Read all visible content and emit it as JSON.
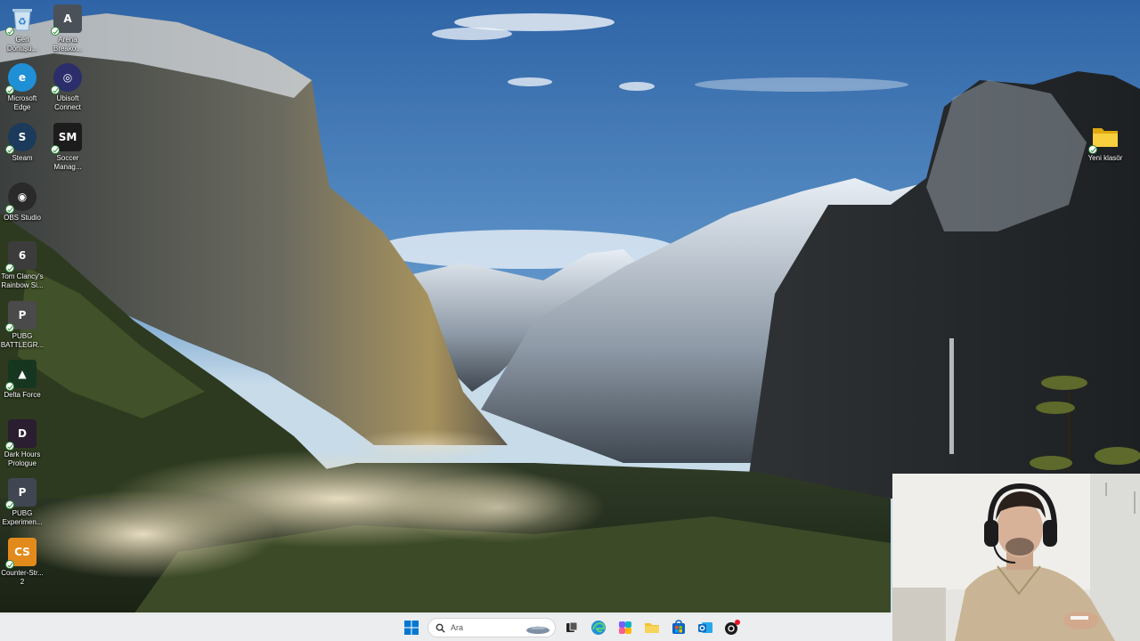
{
  "desktop": {
    "icons": [
      {
        "label": "Geri\nDönüşü...",
        "icon": "recycle-bin-icon",
        "color": "#6ba6d8",
        "glyph": "♻"
      },
      {
        "label": "Arena\nBreako...",
        "icon": "arena-breakout-icon",
        "color": "#4b5158",
        "glyph": "A"
      },
      {
        "label": "Microsoft\nEdge",
        "icon": "edge-icon",
        "color": "#1f8fd6",
        "glyph": "e"
      },
      {
        "label": "Ubisoft\nConnect",
        "icon": "ubisoft-connect-icon",
        "color": "#2b2e6b",
        "glyph": "◎"
      },
      {
        "label": "Steam",
        "icon": "steam-icon",
        "color": "#1b3a5c",
        "glyph": "S"
      },
      {
        "label": "Soccer\nManag...",
        "icon": "soccer-manager-icon",
        "color": "#1c1c1c",
        "glyph": "SM"
      },
      {
        "label": "OBS Studio",
        "icon": "obs-studio-icon",
        "color": "#2a2a2a",
        "glyph": "◉"
      },
      {
        "label": "Tom Clancy's\nRainbow Si...",
        "icon": "rainbow-six-icon",
        "color": "#3c3c3c",
        "glyph": "6"
      },
      {
        "label": "PUBG\nBATTLEGR...",
        "icon": "pubg-icon",
        "color": "#4a4a4a",
        "glyph": "P"
      },
      {
        "label": "Delta Force",
        "icon": "delta-force-icon",
        "color": "#16361f",
        "glyph": "▲"
      },
      {
        "label": "Dark Hours\nPrologue",
        "icon": "dark-hours-icon",
        "color": "#2a1e30",
        "glyph": "D"
      },
      {
        "label": "PUBG\nExperimen...",
        "icon": "pubg-experimental-icon",
        "color": "#404652",
        "glyph": "P"
      },
      {
        "label": "Counter-Str...\n2",
        "icon": "counter-strike-icon",
        "color": "#e28b1c",
        "glyph": "CS"
      },
      {
        "label": "Yeni klasör",
        "icon": "folder-icon",
        "color": "#f1c232",
        "glyph": ""
      }
    ]
  },
  "taskbar": {
    "search_placeholder": "Ara",
    "apps": [
      {
        "name": "start-button",
        "icon": "windows-logo-icon",
        "color": "#0078d4"
      },
      {
        "name": "search-box",
        "icon": "search-icon"
      },
      {
        "name": "task-view-button",
        "icon": "task-view-icon",
        "color": "#222222"
      },
      {
        "name": "taskbar-edge-button",
        "icon": "edge-icon",
        "color": "#1f8fd6"
      },
      {
        "name": "taskbar-copilot-button",
        "icon": "copilot-icon",
        "color": "#7b5cff"
      },
      {
        "name": "taskbar-explorer-button",
        "icon": "folder-icon",
        "color": "#f1c232"
      },
      {
        "name": "taskbar-store-button",
        "icon": "store-icon",
        "color": "#0a64c8"
      },
      {
        "name": "taskbar-outlook-button",
        "icon": "outlook-icon",
        "color": "#0f6cbd"
      },
      {
        "name": "taskbar-app-button",
        "icon": "app-icon",
        "color": "#1a1a1a"
      }
    ]
  }
}
